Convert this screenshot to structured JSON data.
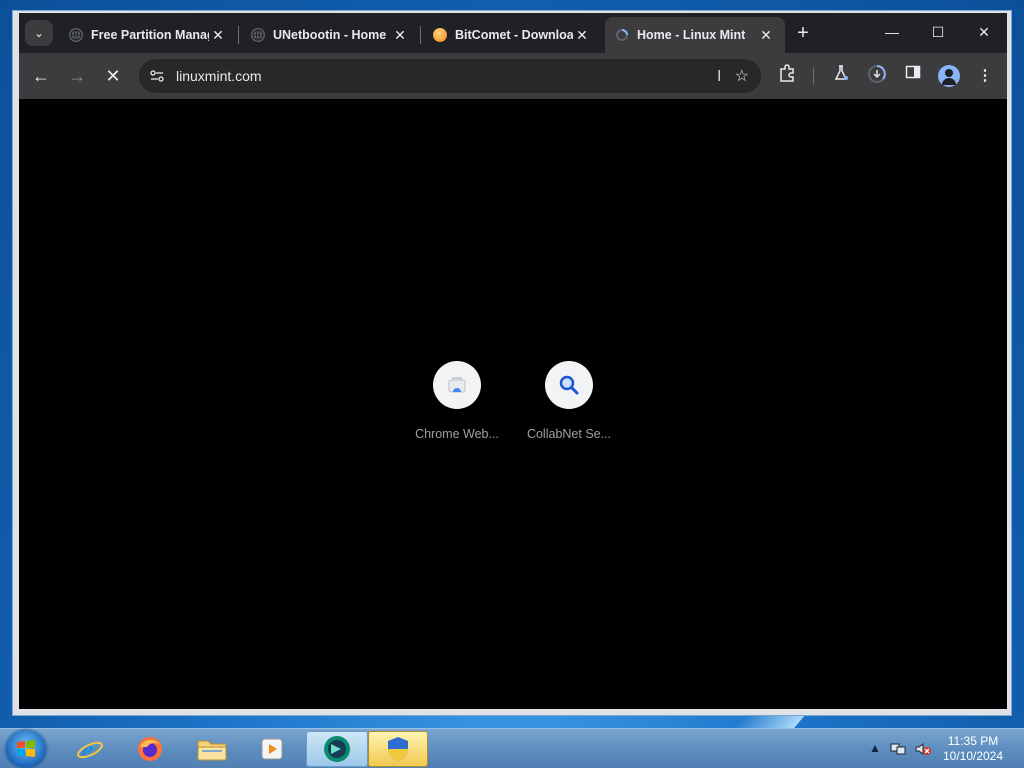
{
  "browser": {
    "tabs": [
      {
        "title": "Free Partition Manag",
        "favicon": "globe-icon"
      },
      {
        "title": "UNetbootin - Home",
        "favicon": "globe-icon"
      },
      {
        "title": "BitComet - Downloa",
        "favicon": "bitcomet-icon"
      },
      {
        "title": "Home - Linux Mint",
        "favicon": "loading-icon",
        "active": true
      }
    ],
    "close_glyph": "✕",
    "new_tab_glyph": "+",
    "window_controls": {
      "minimize": "—",
      "maximize": "☐",
      "close": "✕"
    },
    "address": "linuxmint.com",
    "shortcuts": [
      {
        "label": "Chrome Web...",
        "icon": "chrome-web-store-icon"
      },
      {
        "label": "CollabNet Se...",
        "icon": "search-magnifier-icon"
      }
    ]
  },
  "taskbar": {
    "apps": [
      {
        "name": "Internet Explorer",
        "icon": "ie-icon"
      },
      {
        "name": "Firefox",
        "icon": "firefox-icon"
      },
      {
        "name": "Windows Explorer",
        "icon": "folder-icon"
      },
      {
        "name": "Media Player",
        "icon": "media-icon"
      },
      {
        "name": "Chrome",
        "icon": "chrome-icon",
        "state": "active"
      },
      {
        "name": "Security",
        "icon": "shield-icon",
        "state": "pressed"
      }
    ],
    "clock": {
      "time": "11:35 PM",
      "date": "10/10/2024"
    }
  },
  "colors": {
    "tab_active": "#3c3c3f",
    "toolbar": "#3c3c3f",
    "content_bg": "#000000",
    "taskbar": "#5e8dbf"
  }
}
